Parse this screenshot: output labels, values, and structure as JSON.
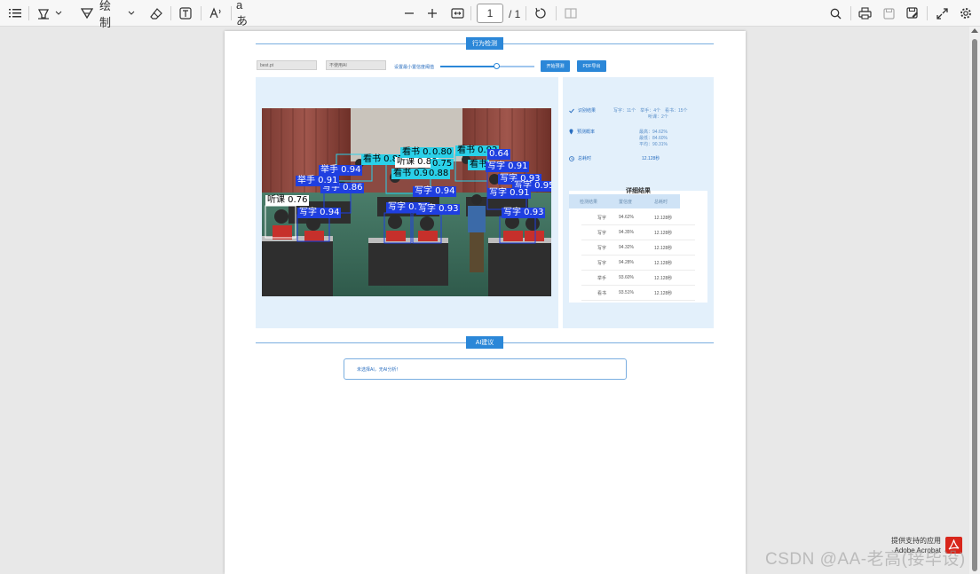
{
  "toolbar": {
    "draw_label": "绘制",
    "page_current": "1",
    "page_total": "/ 1"
  },
  "document": {
    "section1_title": "行为检测",
    "model_input": "best.pt",
    "ai_select": "不使用AI",
    "threshold_label": "设置最小置信度阈值",
    "threshold_value": 0.6,
    "start_button": "开始预测",
    "pdf_button": "PDF导出",
    "summary": {
      "result_label": "识别结果",
      "result_value_line1": "写字：11个　举手：4个　看书：15个",
      "result_value_line2": "听课：2个",
      "prob_label": "预测概率",
      "prob_line1": "最高：94.62%",
      "prob_line2": "最低：84.60%",
      "prob_line3": "平均：90.31%",
      "time_label": "总耗时",
      "time_value": "12.128秒"
    },
    "detail": {
      "title": "详细结果",
      "headers": [
        "检测结果",
        "置信度",
        "总耗时"
      ],
      "rows": [
        [
          "写字",
          "94.62%",
          "12.128秒"
        ],
        [
          "写字",
          "94.35%",
          "12.128秒"
        ],
        [
          "写字",
          "94.32%",
          "12.128秒"
        ],
        [
          "写字",
          "94.28%",
          "12.128秒"
        ],
        [
          "举手",
          "93.60%",
          "12.128秒"
        ],
        [
          "看书",
          "93.51%",
          "12.128秒"
        ]
      ]
    },
    "detections": [
      {
        "label": "听课 0.76",
        "color": "#ffffff",
        "text": "#000000"
      },
      {
        "label": "写字 0.94",
        "color": "#1f3fe0",
        "text": "#ffffff"
      },
      {
        "label": "写字 0.86",
        "color": "#1f3fe0",
        "text": "#ffffff"
      },
      {
        "label": "举手 0.91",
        "color": "#1f3fe0",
        "text": "#ffffff"
      },
      {
        "label": "举手 0.94",
        "color": "#1f3fe0",
        "text": "#ffffff"
      },
      {
        "label": "看书 0.87",
        "color": "#2ad0e8",
        "text": "#000000"
      },
      {
        "label": "听课 0.88",
        "color": "#ffffff",
        "text": "#000000"
      },
      {
        "label": "看书 0.86",
        "color": "#2ad0e8",
        "text": "#000000"
      },
      {
        "label": "看书 0.94",
        "color": "#2ad0e8",
        "text": "#000000"
      },
      {
        "label": "0.88",
        "color": "#2ad0e8",
        "text": "#000000"
      },
      {
        "label": "0.80",
        "color": "#2ad0e8",
        "text": "#000000"
      },
      {
        "label": "0.75",
        "color": "#2ad0e8",
        "text": "#000000"
      },
      {
        "label": "写字 0.94",
        "color": "#1f3fe0",
        "text": "#ffffff"
      },
      {
        "label": "写字 0.94",
        "color": "#1f3fe0",
        "text": "#ffffff"
      },
      {
        "label": "写字 0.93",
        "color": "#1f3fe0",
        "text": "#ffffff"
      },
      {
        "label": "看书 0.92",
        "color": "#2ad0e8",
        "text": "#000000"
      },
      {
        "label": "0.64",
        "color": "#1f3fe0",
        "text": "#ffffff"
      },
      {
        "label": "看书",
        "color": "#2ad0e8",
        "text": "#000000"
      },
      {
        "label": "写字 0.91",
        "color": "#1f3fe0",
        "text": "#ffffff"
      },
      {
        "label": "写字 0.93",
        "color": "#1f3fe0",
        "text": "#ffffff"
      },
      {
        "label": "写字 0.95",
        "color": "#1f3fe0",
        "text": "#ffffff"
      },
      {
        "label": "写字 0.91",
        "color": "#1f3fe0",
        "text": "#ffffff"
      },
      {
        "label": "写字 0.93",
        "color": "#1f3fe0",
        "text": "#ffffff"
      }
    ],
    "section2_title": "AI建议",
    "ai_message": "未选择AI，无AI分析！"
  },
  "overlay": {
    "acrobat_line1": "提供支持的应用",
    "acrobat_line2": "Adobe Acrobat",
    "watermark": "CSDN @AA-老高(接毕设)"
  }
}
